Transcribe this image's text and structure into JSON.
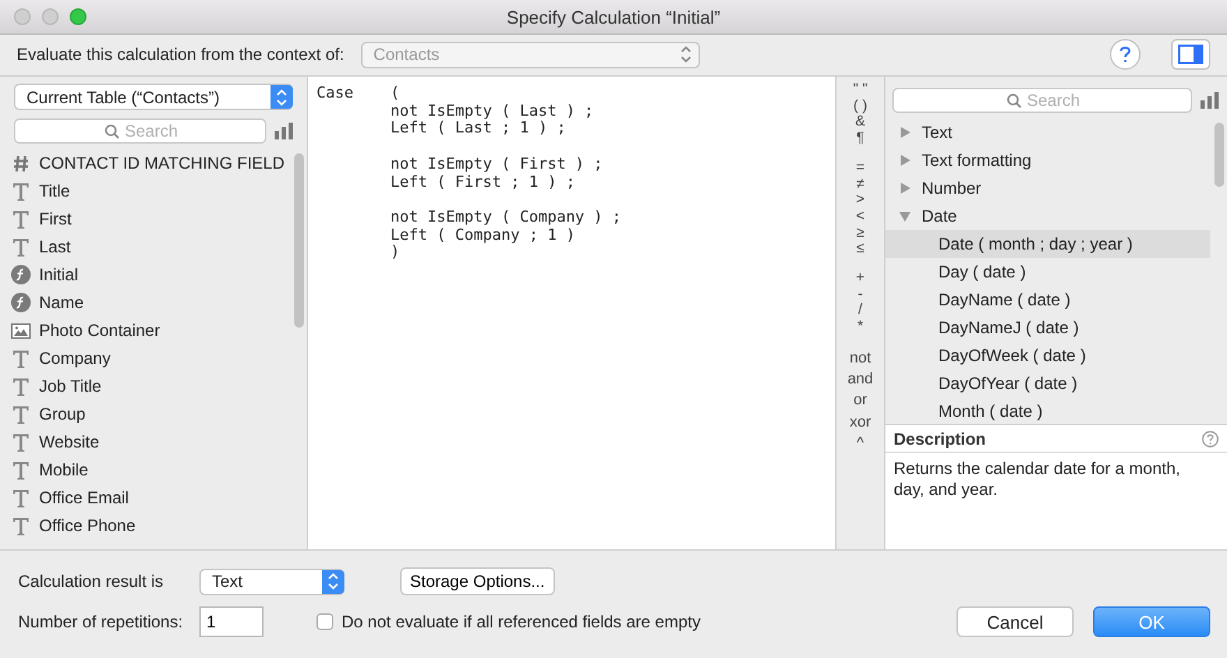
{
  "window": {
    "title": "Specify Calculation “Initial”"
  },
  "context": {
    "label": "Evaluate this calculation from the context of:",
    "value": "Contacts"
  },
  "table_menu": {
    "value": "Current Table (“Contacts”)"
  },
  "field_search": {
    "placeholder": "Search"
  },
  "fields": [
    {
      "name": "CONTACT ID MATCHING FIELD",
      "kind": "number"
    },
    {
      "name": "Title",
      "kind": "text"
    },
    {
      "name": "First",
      "kind": "text"
    },
    {
      "name": "Last",
      "kind": "text"
    },
    {
      "name": "Initial",
      "kind": "calc"
    },
    {
      "name": "Name",
      "kind": "calc"
    },
    {
      "name": "Photo Container",
      "kind": "container"
    },
    {
      "name": "Company",
      "kind": "text"
    },
    {
      "name": "Job Title",
      "kind": "text"
    },
    {
      "name": "Group",
      "kind": "text"
    },
    {
      "name": "Website",
      "kind": "text"
    },
    {
      "name": "Mobile",
      "kind": "text"
    },
    {
      "name": "Office Email",
      "kind": "text"
    },
    {
      "name": "Office Phone",
      "kind": "text"
    }
  ],
  "formula": "Case\t(\n\tnot IsEmpty ( Last ) ;\n\tLeft ( Last ; 1 ) ;\n\n\tnot IsEmpty ( First ) ;\n\tLeft ( First ; 1 ) ;\n\n\tnot IsEmpty ( Company ) ;\n\tLeft ( Company ; 1 )\n\t)",
  "operators": [
    [
      "\" \"",
      "( )",
      "&",
      "¶"
    ],
    [
      "=",
      "≠",
      ">",
      "<",
      "≥",
      "≤"
    ],
    [
      "+",
      "-",
      "/",
      "*"
    ],
    [
      "not",
      "and",
      "or",
      "xor",
      "^"
    ]
  ],
  "function_search": {
    "placeholder": "Search"
  },
  "functions": [
    {
      "label": "Text",
      "expanded": false
    },
    {
      "label": "Text formatting",
      "expanded": false
    },
    {
      "label": "Number",
      "expanded": false
    },
    {
      "label": "Date",
      "expanded": true,
      "children": [
        {
          "label": "Date ( month ; day ; year )",
          "selected": true
        },
        {
          "label": "Day ( date )",
          "selected": false
        },
        {
          "label": "DayName ( date )",
          "selected": false
        },
        {
          "label": "DayNameJ ( date )",
          "selected": false
        },
        {
          "label": "DayOfWeek ( date )",
          "selected": false
        },
        {
          "label": "DayOfYear ( date )",
          "selected": false
        },
        {
          "label": "Month ( date )",
          "selected": false
        }
      ]
    }
  ],
  "description": {
    "title": "Description",
    "text": "Returns the calendar date for a month, day, and year."
  },
  "result": {
    "label": "Calculation result is",
    "value": "Text"
  },
  "storage_button": "Storage Options...",
  "repetitions": {
    "label": "Number of repetitions:",
    "value": "1"
  },
  "no_evaluate": {
    "label": "Do not evaluate if all referenced fields are empty",
    "checked": false
  },
  "buttons": [
    {
      "label": "Cancel",
      "kind": "normal"
    },
    {
      "label": "OK",
      "kind": "default"
    }
  ]
}
